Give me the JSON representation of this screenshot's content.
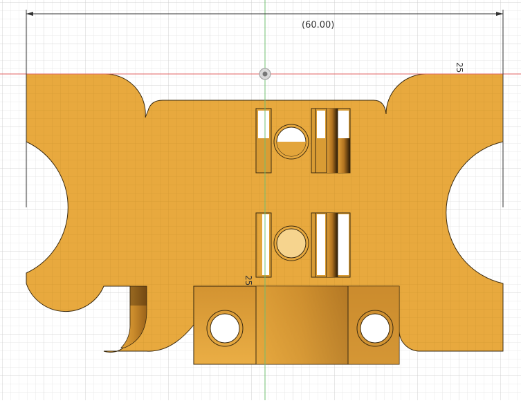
{
  "sketch": {
    "horizontal_dimension": "(60.00)",
    "right_dimension": "25",
    "center_dimension": "25"
  },
  "colors": {
    "part_fill": "#E8A93E",
    "part_edge": "#3a2a10",
    "grid_minor": "#e6e6e6",
    "grid_major": "#cfcfcf",
    "axis_red": "#e06060",
    "axis_green": "#6fbf6f",
    "background": "#ffffff"
  },
  "icons": {
    "origin": "origin-point-icon"
  }
}
